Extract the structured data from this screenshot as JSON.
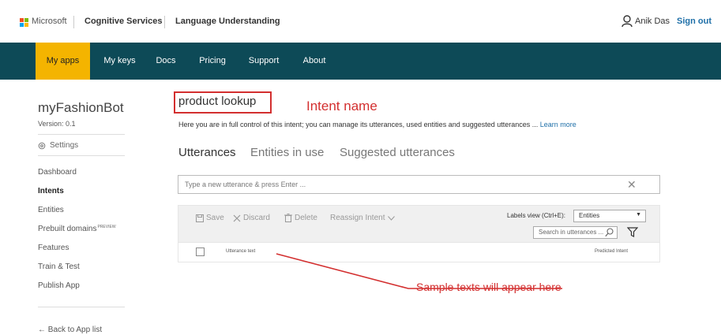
{
  "header": {
    "ms_text": "Microsoft",
    "brand_primary": "Cognitive Services",
    "brand_secondary": "Language Understanding",
    "user_name": "Anik Das",
    "sign_out": "Sign out"
  },
  "nav": {
    "items": [
      {
        "label": "My apps",
        "active": true
      },
      {
        "label": "My keys"
      },
      {
        "label": "Docs"
      },
      {
        "label": "Pricing"
      },
      {
        "label": "Support"
      },
      {
        "label": "About"
      }
    ]
  },
  "sidebar": {
    "app_name": "myFashionBot",
    "version": "Version: 0.1",
    "settings": "Settings",
    "links": [
      "Dashboard",
      "Intents",
      "Entities",
      "Prebuilt domains",
      "Features",
      "Train & Test",
      "Publish App"
    ],
    "preview_tag": "PREVIEW",
    "back": "← Back to App list"
  },
  "main": {
    "intent_name": "product lookup",
    "intent_annotation": "Intent name",
    "description": "Here you are in full control of this intent; you can manage its utterances, used entities and suggested utterances ...",
    "learn_more": "Learn more",
    "tabs": [
      "Utterances",
      "Entities in use",
      "Suggested utterances"
    ],
    "utterance_placeholder": "Type a new utterance & press Enter ...",
    "clear_glyph": "✕",
    "toolbar": {
      "save": "Save",
      "discard": "Discard",
      "delete": "Delete",
      "reassign": "Reassign Intent",
      "labels_view": "Labels view (Ctrl+E):",
      "labels_value": "Entities",
      "search_placeholder": "Search in utterances ..."
    },
    "table": {
      "col_utterance": "Utterance text",
      "col_predicted": "Predicted Intent"
    },
    "sample_annotation": "Sample texts will appear here"
  },
  "colors": {
    "nav_bg": "#0d4a57",
    "nav_active": "#f4b400",
    "annotation": "#d32f2f",
    "link": "#1e6fa8"
  },
  "icons": [
    "microsoft-logo",
    "user-icon",
    "gear-icon",
    "close-icon",
    "save-icon",
    "discard-icon",
    "delete-icon",
    "chevron-down-icon",
    "search-icon",
    "filter-icon"
  ]
}
